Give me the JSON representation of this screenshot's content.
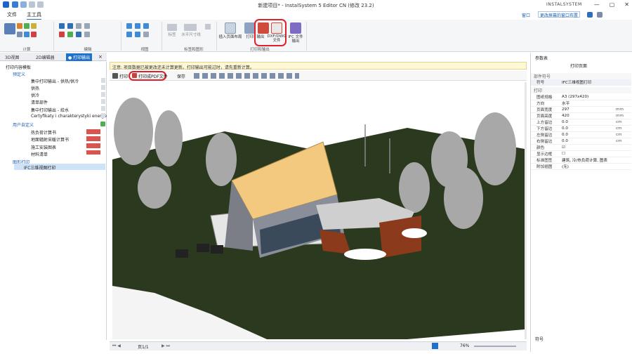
{
  "window": {
    "title": "新建项目* - InstalSystem 5 Editor CN (修改 23.2)",
    "controls": [
      "—",
      "▢",
      "✕"
    ]
  },
  "brand": {
    "name": "INSTALSYSTEM"
  },
  "menu": {
    "file": "文件",
    "main": "主工具"
  },
  "header": {
    "window_menu": "窗口",
    "layout_select": "更改屏幕的窗口布置"
  },
  "ribbon": {
    "groups": {
      "calc": "计算",
      "edit": "编辑",
      "view": "视图",
      "annot": "标签和图形",
      "print": "打印和输出"
    },
    "insert_page": "插入页面布局",
    "print": "打印",
    "export": "输出",
    "dxf": "DXF/DWG 文件",
    "ifc": "IFC 文件输出",
    "label_btn": "标签",
    "horiz_size": "水平尺寸线"
  },
  "doc_tabs": [
    "3D视图",
    "2D编辑器",
    "● 打印输出"
  ],
  "tree": {
    "root": "打印内容模板",
    "predef": "预定义",
    "items_predef": [
      "集中打印输出 - 供热/供冷",
      "供热",
      "供冷",
      "清单部件",
      "集中打印输出 - 给水",
      "Certyfikaty i charakterystyki energe"
    ],
    "user": "用户自定义",
    "items_user": [
      "热负荷计算书",
      "地面辐射采暖计算书",
      "施工安装图表",
      "材料清单"
    ],
    "plot": "图形打印",
    "plot_item": "IFC三维视图打印"
  },
  "notice": "注意: 项目数据已被更改还未计算更新。打印输出可能过时，请先重新计算。",
  "print_toolbar": {
    "print": "打印",
    "pdf": "打印成PDF文件",
    "save": "保存"
  },
  "statusbar": {
    "page": "页1/1",
    "zoom": "76%"
  },
  "right_panel": {
    "title": "参数表",
    "subtitle": "打印页面",
    "sec_component": "部件符号",
    "symbol_label": "符号",
    "symbol_value": "IFC三维视图打印",
    "sec_print": "打印",
    "rows": [
      {
        "name": "图纸规格",
        "value": "A3 (297x420)",
        "unit": ""
      },
      {
        "name": "方向",
        "value": "水平",
        "unit": ""
      },
      {
        "name": "页面宽度",
        "value": "297",
        "unit": "mm"
      },
      {
        "name": "页面高度",
        "value": "420",
        "unit": "mm"
      },
      {
        "name": "上方留边",
        "value": "0.0",
        "unit": "cm"
      },
      {
        "name": "下方留边",
        "value": "0.0",
        "unit": "cm"
      },
      {
        "name": "左侧留边",
        "value": "0.0",
        "unit": "cm"
      },
      {
        "name": "右侧留边",
        "value": "0.0",
        "unit": "cm"
      },
      {
        "name": "颜色",
        "value": "☑",
        "unit": ""
      },
      {
        "name": "显示边框",
        "value": "☐",
        "unit": ""
      },
      {
        "name": "标准图签",
        "value": "建筑, 冷/热负荷计算, 图表",
        "unit": ""
      },
      {
        "name": "附加插图",
        "value": "(无)",
        "unit": ""
      }
    ],
    "footer": "符号"
  }
}
